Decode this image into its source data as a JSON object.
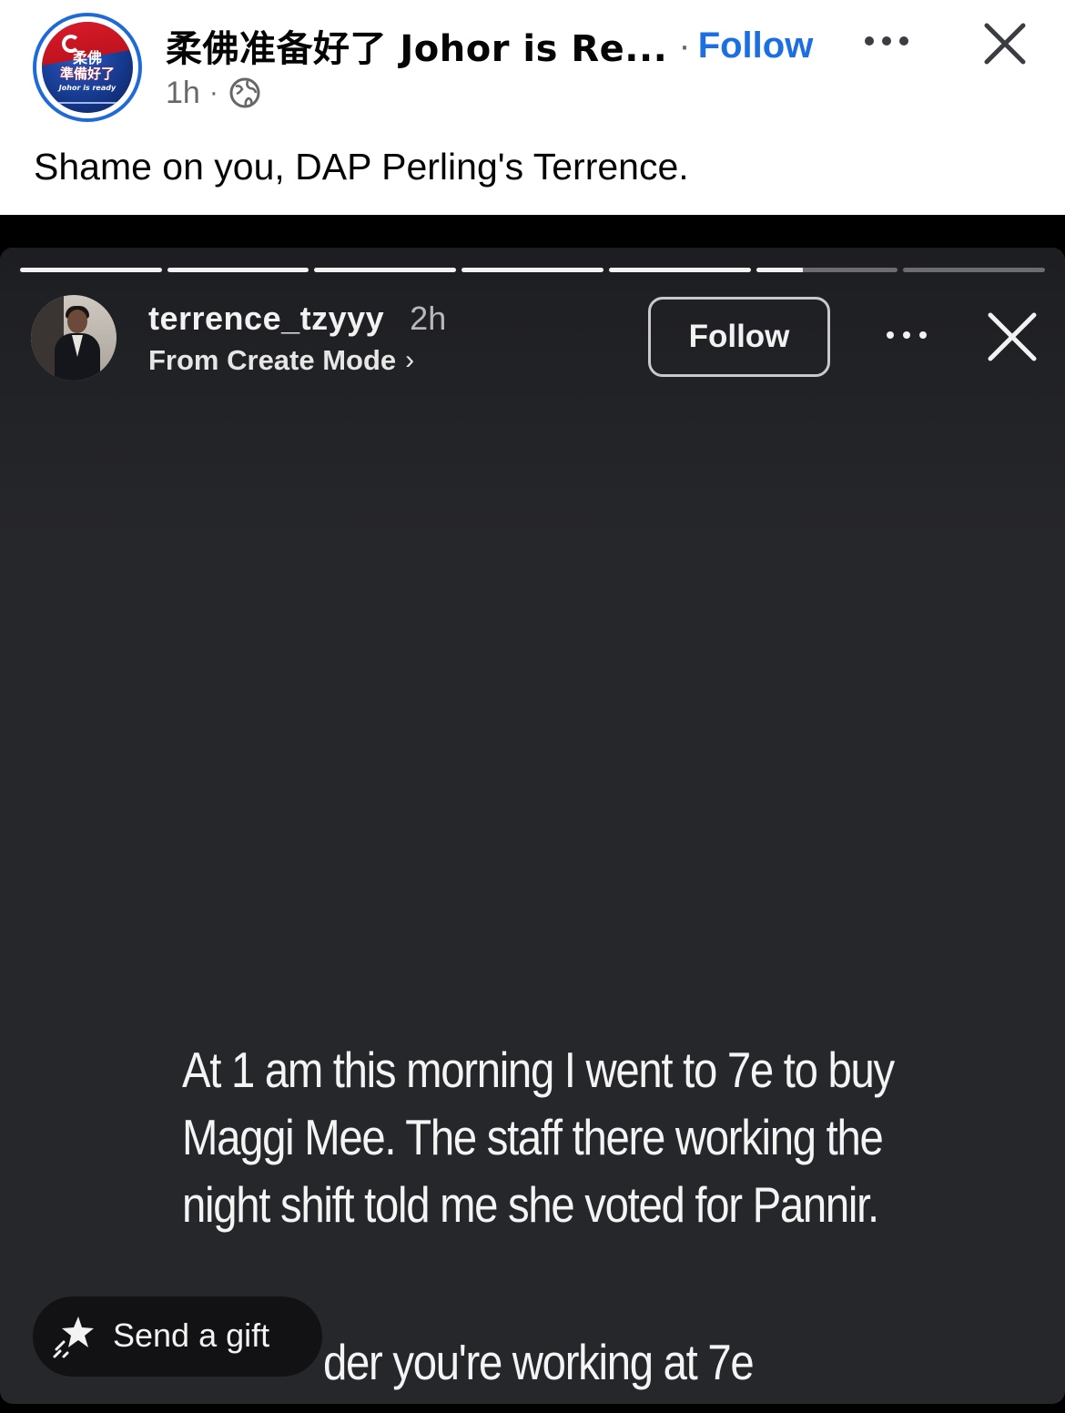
{
  "post": {
    "page_name": "柔佛准备好了 Johor is Re...",
    "separator": "·",
    "follow_label": "Follow",
    "time": "1h",
    "meta_dot": "·",
    "text": "Shame on you, DAP Perling's Terrence.",
    "avatar_logo_line1": "柔佛",
    "avatar_logo_line2": "準備好了",
    "avatar_logo_line3": "Johor is ready"
  },
  "story": {
    "progress_segments": [
      1,
      1,
      1,
      1,
      1,
      0.33,
      0
    ],
    "username": "terrence_tzyyy",
    "time": "2h",
    "subtitle": "From Create Mode",
    "subtitle_chevron": "›",
    "follow_label": "Follow",
    "text_lines": [
      "At 1 am this morning I went to 7e to buy",
      "Maggi Mee. The staff there working the",
      "night shift told me she voted for Pannir."
    ],
    "text_last_line": "der you're working at 7e",
    "gift_label": "Send a gift"
  },
  "colors": {
    "fb_link_blue": "#1b6fe0",
    "story_bg": "#26272b",
    "avatar_ring": "#1f6ad6"
  }
}
